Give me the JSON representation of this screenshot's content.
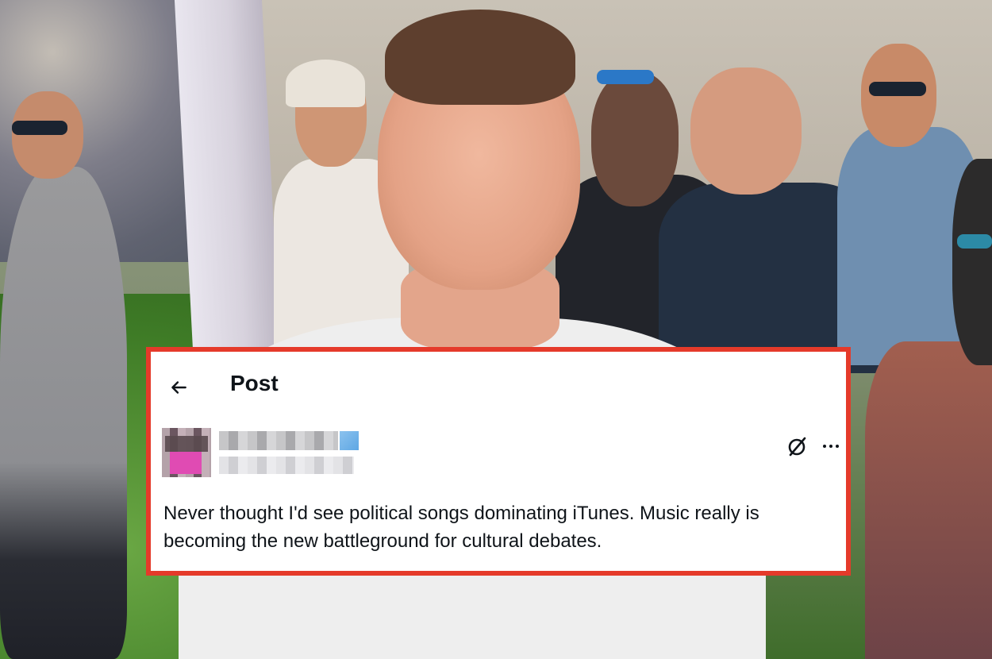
{
  "post": {
    "title": "Post",
    "body": "Never thought I'd see political songs dominating iTunes. Music really is becoming the new battleground for cultural debates."
  },
  "icons": {
    "back": "arrow-left-icon",
    "grok": "grok-icon",
    "more": "more-horizontal-icon"
  },
  "colors": {
    "frame": "#e53a2a",
    "text": "#0f1419",
    "card_bg": "#ffffff"
  }
}
